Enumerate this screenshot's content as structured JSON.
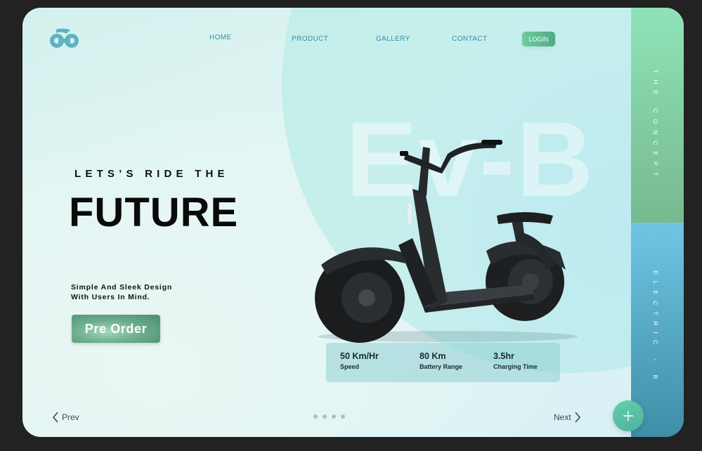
{
  "nav": {
    "items": [
      "HOME",
      "PRODUCT",
      "GALLERY",
      "CONTACT"
    ],
    "login": "LOGIN"
  },
  "watermark": "Ev-B",
  "hero": {
    "tagline": "LETS’S RIDE THE",
    "headline": "FUTURE",
    "description": "Simple And Sleek Design With Users In Mind.",
    "cta": "Pre  Order"
  },
  "stats": [
    {
      "value": "50 Km/Hr",
      "label": "Speed"
    },
    {
      "value": "80 Km",
      "label": "Battery Range"
    },
    {
      "value": "3.5hr",
      "label": "Charging Time"
    }
  ],
  "pager": {
    "prev": "Prev",
    "next": "Next",
    "dot_count": 4
  },
  "sidebar": {
    "top": "THE CONCEPT",
    "bottom": "ELECTRIC - B"
  },
  "fab_icon": "plus-icon",
  "colors": {
    "accent": "#4fa987",
    "nav": "#3b8eaa",
    "side_top": "#8fe3b8",
    "side_bottom": "#3f8ea7"
  }
}
